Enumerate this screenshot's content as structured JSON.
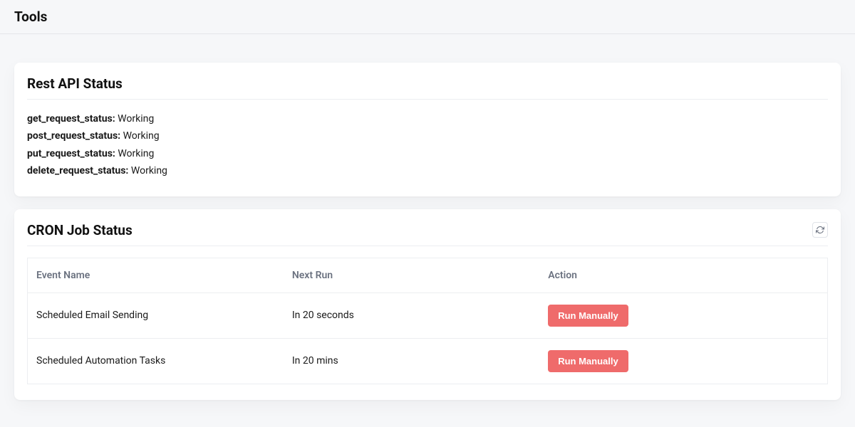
{
  "header": {
    "title": "Tools"
  },
  "rest_api": {
    "title": "Rest API Status",
    "items": [
      {
        "key": "get_request_status:",
        "value": "Working"
      },
      {
        "key": "post_request_status:",
        "value": "Working"
      },
      {
        "key": "put_request_status:",
        "value": "Working"
      },
      {
        "key": "delete_request_status:",
        "value": "Working"
      }
    ]
  },
  "cron": {
    "title": "CRON Job Status",
    "columns": {
      "event": "Event Name",
      "next": "Next Run",
      "action": "Action"
    },
    "run_label": "Run Manually",
    "rows": [
      {
        "event": "Scheduled Email Sending",
        "next": "In 20 seconds"
      },
      {
        "event": "Scheduled Automation Tasks",
        "next": "In 20 mins"
      }
    ]
  }
}
